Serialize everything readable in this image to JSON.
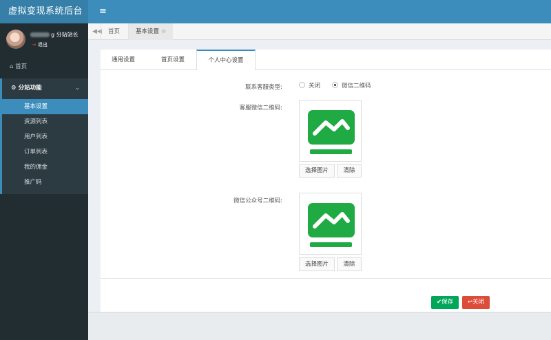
{
  "app": {
    "title": "虚拟变现系统后台",
    "menu_icon": "≡"
  },
  "user": {
    "role": "g 分站站长",
    "logout": "退出"
  },
  "nav": {
    "home": "首页",
    "group": "分站功能",
    "items": [
      "基本设置",
      "资源列表",
      "用户列表",
      "订单列表",
      "我的佣金",
      "推广码"
    ],
    "active_index": 0
  },
  "tabs": [
    {
      "label": "首页"
    },
    {
      "label": "基本设置",
      "close": "⊗"
    }
  ],
  "panel": {
    "tabs": [
      "通用设置",
      "首页设置",
      "个人中心设置"
    ],
    "active_tab": 2,
    "fields": {
      "service_type": {
        "label": "联系客服类型:",
        "options": [
          "关闭",
          "微信二维码"
        ],
        "selected": 1
      },
      "service_qr": {
        "label": "客服微信二维码:",
        "choose": "选择图片",
        "clear": "清除"
      },
      "mp_qr": {
        "label": "微信公众号二维码:",
        "choose": "选择图片",
        "clear": "清除"
      }
    },
    "save": "✔保存",
    "close": "↩关闭"
  },
  "colors": {
    "header": "#3c8dbc",
    "sidebar": "#222d32",
    "save": "#00a65a",
    "close": "#dd4b39",
    "qr_green": "#1faa43"
  }
}
